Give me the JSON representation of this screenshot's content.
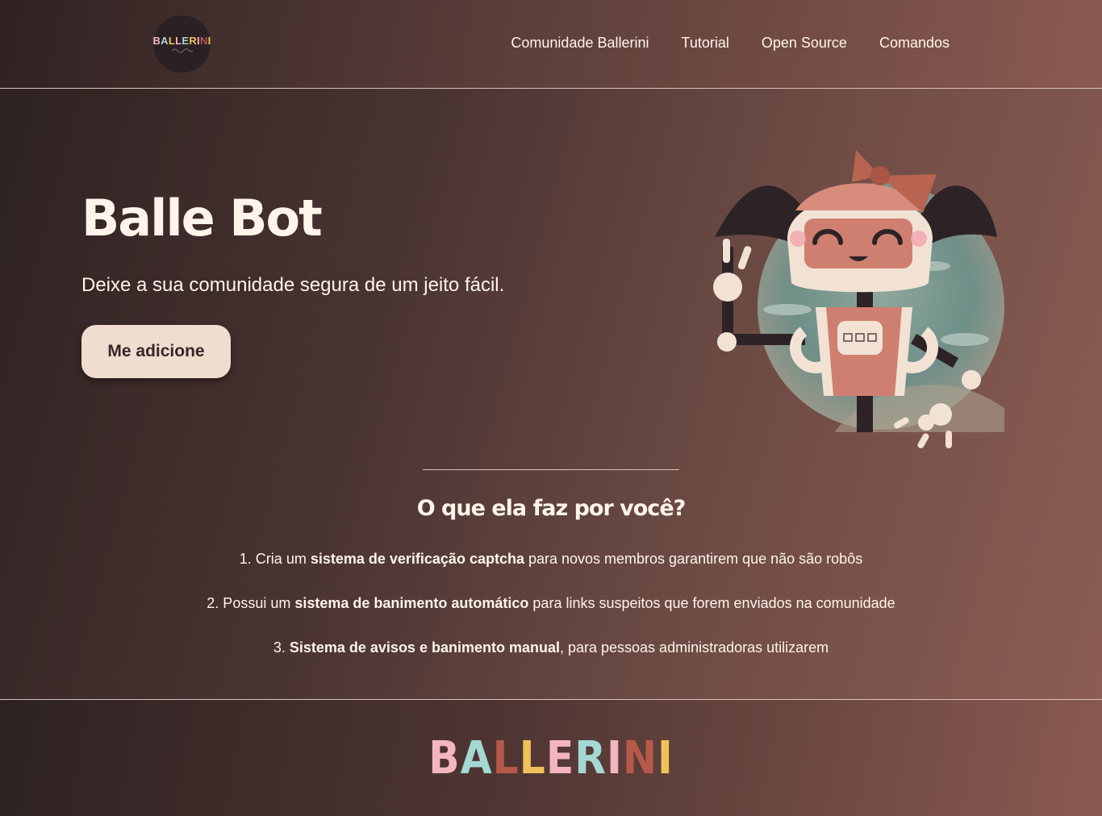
{
  "header": {
    "logo_text": "BALLERINI",
    "nav": [
      "Comunidade Ballerini",
      "Tutorial",
      "Open Source",
      "Comandos"
    ]
  },
  "hero": {
    "title": "Balle Bot",
    "subtitle": "Deixe a sua comunidade segura de um jeito fácil.",
    "cta_label": "Me adicione"
  },
  "features": {
    "title": "O que ela faz por você?",
    "items": [
      {
        "prefix": "1. Cria um ",
        "bold": "sistema de verificação captcha",
        "suffix": " para novos membros garantirem que não são robôs"
      },
      {
        "prefix": "2. Possui um ",
        "bold": "sistema de banimento automático",
        "suffix": " para links suspeitos que forem enviados na comunidade"
      },
      {
        "prefix": "3. ",
        "bold": "Sistema de avisos e banimento manual",
        "suffix": ", para pessoas administradoras utilizarem"
      }
    ]
  },
  "footer": {
    "brand_letters": [
      "B",
      "A",
      "L",
      "L",
      "E",
      "R",
      "I",
      "N",
      "I"
    ]
  },
  "colors": {
    "brand_letters": [
      "#f3b6bf",
      "#a4d8d3",
      "#b6594b",
      "#f0c35a",
      "#f3b6bf",
      "#a4d8d3",
      "#f3b6bf",
      "#b6594b",
      "#f0c35a"
    ],
    "cta_background": "#f0ddd0",
    "text": "#fff4ea"
  },
  "icons": [
    "ballerini-logo-icon",
    "robot-mascot-illustration"
  ]
}
